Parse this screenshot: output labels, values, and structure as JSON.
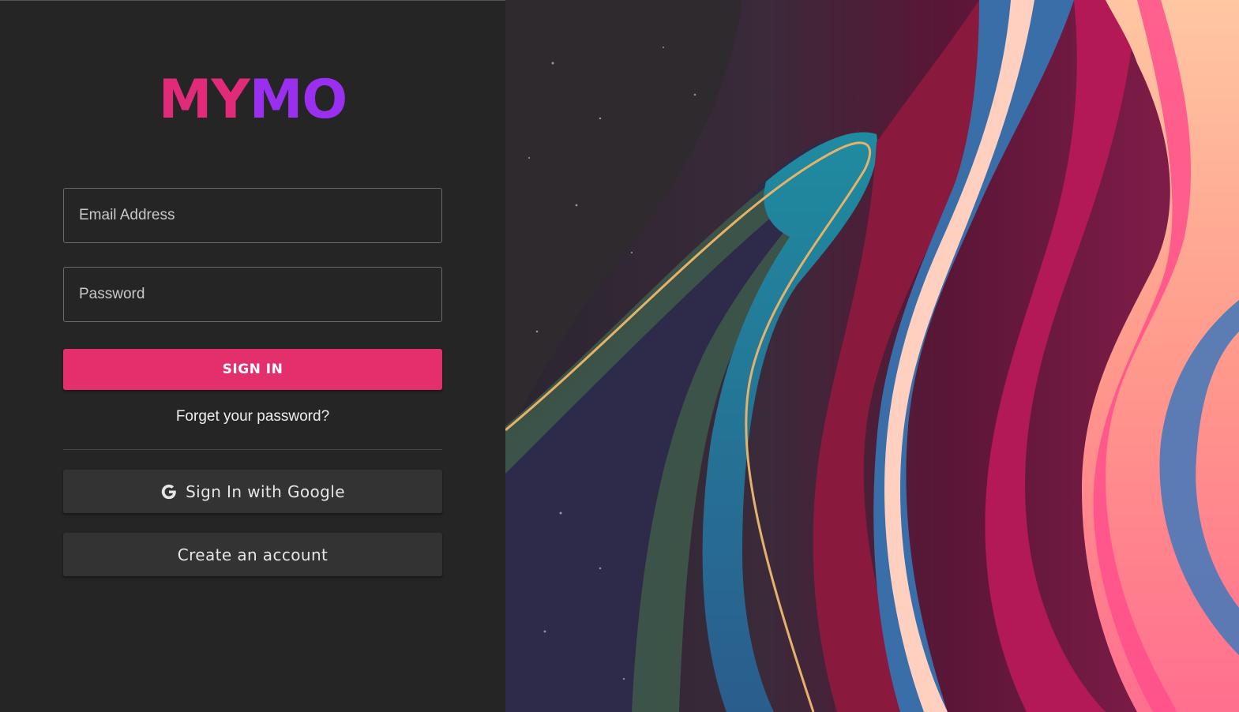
{
  "app": {
    "logo_part_a": "MY",
    "logo_part_b": "MO",
    "logo_colors": {
      "part_a": "#e22b78",
      "part_b": "#9a2ff0"
    }
  },
  "login_form": {
    "email_placeholder": "Email Address",
    "password_placeholder": "Password",
    "sign_in_label": "SIGN IN",
    "forgot_password_label": "Forget your password?",
    "google_sign_in_label": "Sign In with Google",
    "create_account_label": "Create an account"
  },
  "icons": {
    "google": "google-g-icon"
  },
  "colors": {
    "panel_background": "#252525",
    "primary_button": "#e42f6d",
    "secondary_button": "#333333"
  }
}
